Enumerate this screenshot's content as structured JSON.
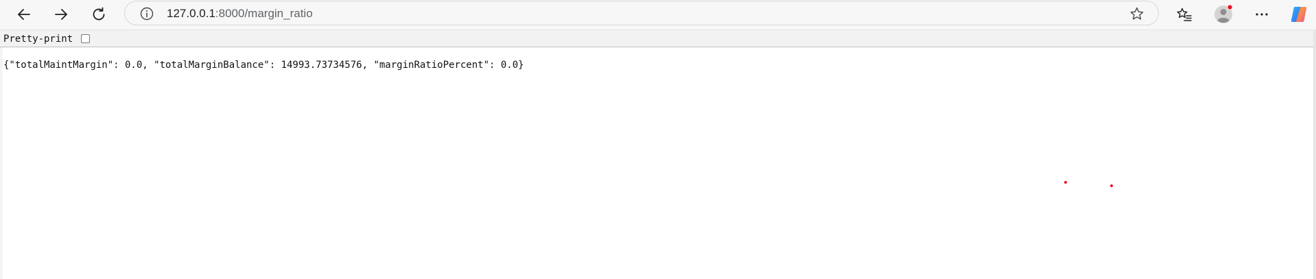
{
  "browser": {
    "url_host": "127.0.0.1",
    "url_rest": ":8000/margin_ratio",
    "icons": {
      "back": "back-arrow-icon",
      "forward": "forward-arrow-icon",
      "refresh": "refresh-icon",
      "site_info": "info-icon",
      "favorite": "star-icon",
      "favorites_list": "favorites-icon",
      "profile": "profile-avatar-icon",
      "more": "more-menu-icon",
      "copilot": "copilot-icon"
    },
    "notification_color": "#e81123"
  },
  "json_viewer": {
    "pretty_print_label": "Pretty-print",
    "pretty_print_checked": false,
    "body_text": "{\"totalMaintMargin\": 0.0, \"totalMarginBalance\": 14993.73734576, \"marginRatioPercent\": 0.0}"
  }
}
